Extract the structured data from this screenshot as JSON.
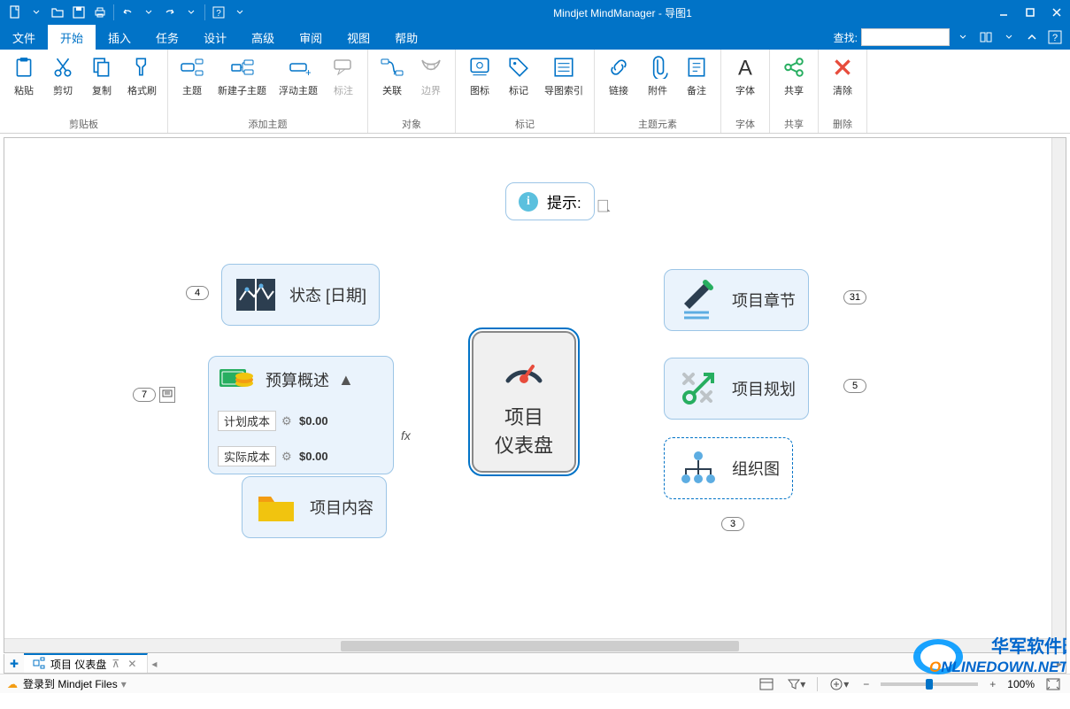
{
  "title_bar": {
    "title": "Mindjet MindManager - 导图1"
  },
  "menu": {
    "items": [
      "文件",
      "开始",
      "插入",
      "任务",
      "设计",
      "高级",
      "审阅",
      "视图",
      "帮助"
    ],
    "active_index": 1,
    "search_label": "查找:",
    "search_value": ""
  },
  "ribbon": {
    "groups": [
      {
        "label": "剪贴板",
        "buttons": [
          {
            "icon": "paste",
            "label": "粘贴"
          },
          {
            "icon": "cut",
            "label": "剪切"
          },
          {
            "icon": "copy",
            "label": "复制"
          },
          {
            "icon": "format-painter",
            "label": "格式刷"
          }
        ]
      },
      {
        "label": "添加主题",
        "buttons": [
          {
            "icon": "topic",
            "label": "主题"
          },
          {
            "icon": "subtopic",
            "label": "新建子主题"
          },
          {
            "icon": "float-topic",
            "label": "浮动主题"
          },
          {
            "icon": "callout",
            "label": "标注",
            "disabled": true
          }
        ]
      },
      {
        "label": "对象",
        "buttons": [
          {
            "icon": "relationship",
            "label": "关联"
          },
          {
            "icon": "boundary",
            "label": "边界",
            "disabled": true
          }
        ]
      },
      {
        "label": "标记",
        "buttons": [
          {
            "icon": "icons",
            "label": "图标"
          },
          {
            "icon": "tags",
            "label": "标记"
          },
          {
            "icon": "index",
            "label": "导图索引"
          }
        ]
      },
      {
        "label": "主题元素",
        "buttons": [
          {
            "icon": "link",
            "label": "链接"
          },
          {
            "icon": "attachment",
            "label": "附件"
          },
          {
            "icon": "notes",
            "label": "备注"
          }
        ]
      },
      {
        "label": "字体",
        "buttons": [
          {
            "icon": "font",
            "label": "字体"
          }
        ]
      },
      {
        "label": "共享",
        "buttons": [
          {
            "icon": "share",
            "label": "共享",
            "green": true
          }
        ]
      },
      {
        "label": "删除",
        "buttons": [
          {
            "icon": "delete",
            "label": "清除",
            "red": true
          }
        ]
      }
    ]
  },
  "canvas": {
    "hint": {
      "label": "提示:"
    },
    "central": {
      "label1": "项目",
      "label2": "仪表盘"
    },
    "nodes": {
      "status": {
        "label": "状态 [日期]",
        "count": "4"
      },
      "budget": {
        "label": "预算概述",
        "rows": [
          {
            "label": "计划成本",
            "value": "$0.00"
          },
          {
            "label": "实际成本",
            "value": "$0.00"
          }
        ],
        "count": "7",
        "fx": "fx"
      },
      "content": {
        "label": "项目内容"
      },
      "chapter": {
        "label": "项目章节",
        "count": "31"
      },
      "planning": {
        "label": "项目规划",
        "count": "5"
      },
      "org": {
        "label": "组织图",
        "count": "3"
      }
    }
  },
  "tabs": {
    "active": "项目 仪表盘"
  },
  "status": {
    "login": "登录到 Mindjet Files",
    "zoom": "100%"
  },
  "watermark": {
    "line1": "华军软件园",
    "line2a": "O",
    "line2b": "NLINEDOWN",
    "line2c": ".NET"
  }
}
